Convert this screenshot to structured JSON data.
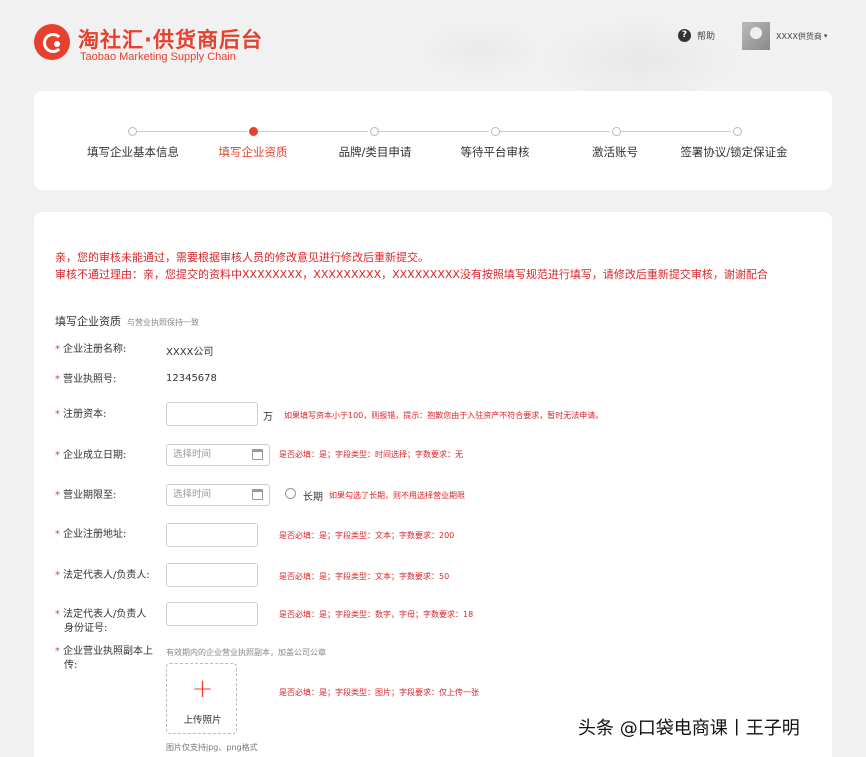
{
  "header": {
    "logo_title": "淘社汇·供货商后台",
    "logo_sub": "Taobao Marketing Supply Chain",
    "help_label": "帮助",
    "user_name": "XXXX供货商",
    "help_icon": "?",
    "caret": "▾"
  },
  "steps": [
    {
      "label": "填写企业基本信息",
      "active": false
    },
    {
      "label": "填写企业资质",
      "active": true
    },
    {
      "label": "品牌/类目申请",
      "active": false
    },
    {
      "label": "等待平台审核",
      "active": false
    },
    {
      "label": "激活账号",
      "active": false
    },
    {
      "label": "签署协议/锁定保证金",
      "active": false
    }
  ],
  "notice": {
    "line1": "亲，您的审核未能通过，需要根据审核人员的修改意见进行修改后重新提交。",
    "line2": "审核不通过理由：亲，您提交的资料中XXXXXXXX，XXXXXXXXX，XXXXXXXXX没有按照填写规范进行填写，请修改后重新提交审核，谢谢配合"
  },
  "section": {
    "title": "填写企业资质",
    "hint": "与营业执照保持一致"
  },
  "required_mark": "*",
  "form": {
    "company_name": {
      "label": "企业注册名称:",
      "value": "XXXX公司"
    },
    "license_no": {
      "label": "营业执照号:",
      "value": "12345678"
    },
    "capital": {
      "label": "注册资本:",
      "unit": "万",
      "rule": "如果填写资本小于100，则报错，提示：抱歉您由于入驻资产不符合要求，暂时无法申请。"
    },
    "founded": {
      "label": "企业成立日期:",
      "placeholder": "选择时间",
      "rule": "是否必填：是；字段类型：时间选择；字数要求：无"
    },
    "term": {
      "label": "营业期限至:",
      "placeholder": "选择时间",
      "radio_label": "长期",
      "rule": "如果勾选了长期，则不用选择营业期限"
    },
    "address": {
      "label": "企业注册地址:",
      "rule": "是否必填：是；字段类型：文本；字数要求：200"
    },
    "legal_rep": {
      "label": "法定代表人/负责人:",
      "rule": "是否必填：是；字段类型：文本；字数要求：50"
    },
    "id_no": {
      "label_line1": "法定代表人/负责人",
      "label_line2": "身份证号:",
      "rule": "是否必填：是；字段类型：数字，字母；字数要求：18"
    },
    "upload": {
      "label_line1": "企业营业执照副本上",
      "label_line2": "传:",
      "hint": "有效期内的企业营业执照副本，加盖公司公章",
      "button_label": "上传照片",
      "plus": "+",
      "rule": "是否必填：是；字段类型：图片；字段要求：仅上传一张",
      "note": "图片仅支持jpg、png格式"
    }
  },
  "watermark": "头条 @口袋电商课丨王子明"
}
